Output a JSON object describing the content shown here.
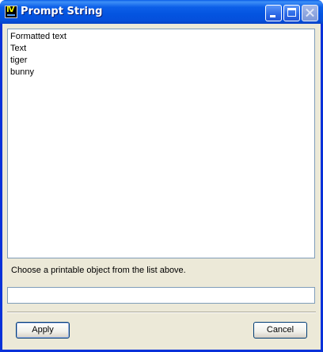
{
  "window": {
    "title": "Prompt String",
    "app_icon": "iv-app-icon"
  },
  "list": {
    "items": [
      "Formatted text",
      "Text",
      "tiger",
      "bunny"
    ]
  },
  "hint": "Choose a printable object from the list above.",
  "text_field": {
    "value": "",
    "placeholder": ""
  },
  "buttons": {
    "apply": "Apply",
    "cancel": "Cancel"
  }
}
